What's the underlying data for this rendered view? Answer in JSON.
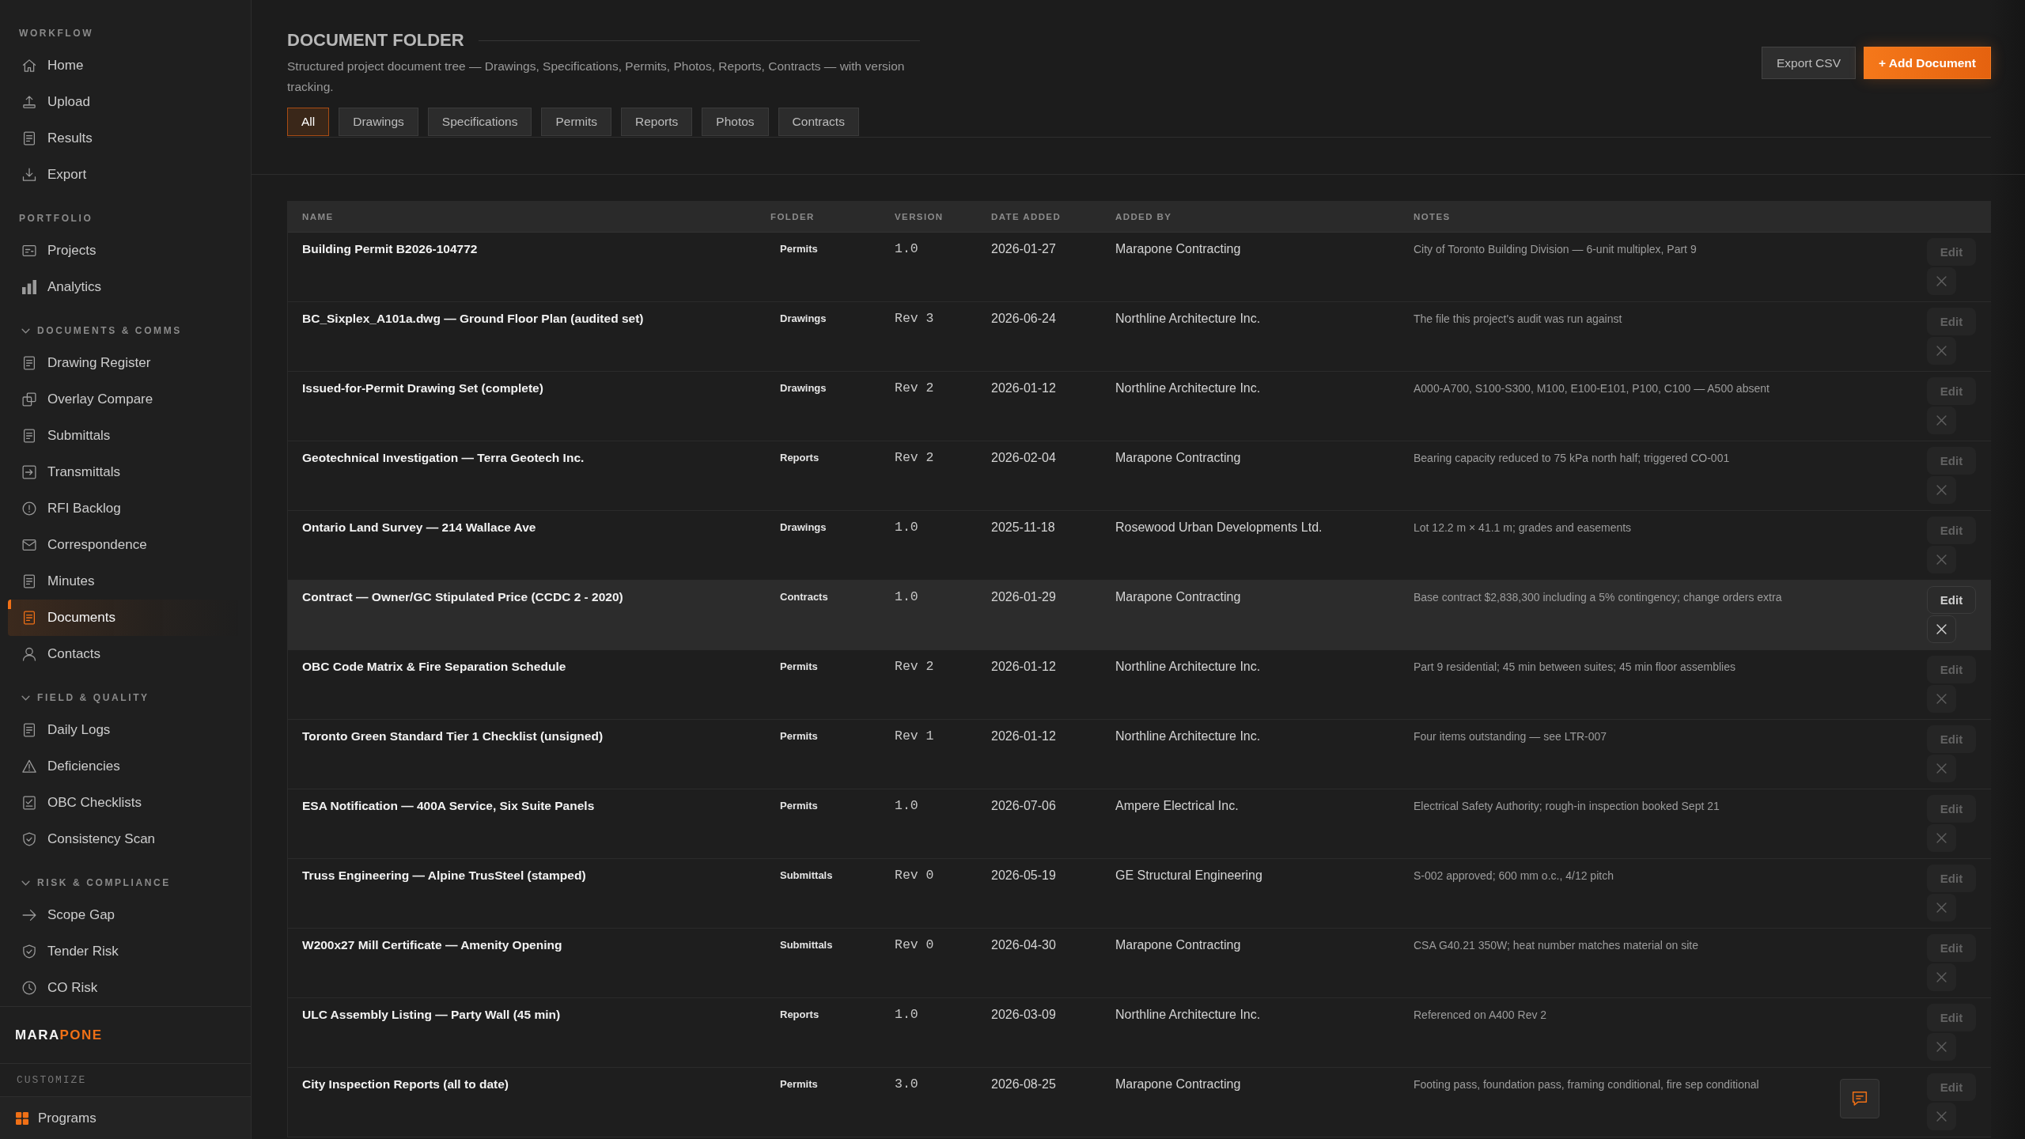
{
  "sidebar": {
    "sections": [
      {
        "label": "WORKFLOW",
        "items": [
          {
            "label": "Home",
            "selected": false
          },
          {
            "label": "Upload",
            "selected": false
          },
          {
            "label": "Results",
            "selected": false
          },
          {
            "label": "Export",
            "selected": false
          }
        ]
      },
      {
        "label": "PORTFOLIO",
        "items": [
          {
            "label": "Projects",
            "selected": false
          },
          {
            "label": "Analytics",
            "selected": false
          }
        ]
      },
      {
        "label": "DOCUMENTS & COMMS",
        "expanded": true,
        "items": [
          {
            "label": "Drawing Register",
            "selected": false
          },
          {
            "label": "Overlay Compare",
            "selected": false
          },
          {
            "label": "Submittals",
            "selected": false
          },
          {
            "label": "Transmittals",
            "selected": false
          },
          {
            "label": "RFI Backlog",
            "selected": false
          },
          {
            "label": "Correspondence",
            "selected": false
          },
          {
            "label": "Minutes",
            "selected": false
          },
          {
            "label": "Documents",
            "selected": true
          },
          {
            "label": "Contacts",
            "selected": false
          }
        ]
      },
      {
        "label": "FIELD & QUALITY",
        "expanded": true,
        "items": [
          {
            "label": "Daily Logs",
            "selected": false
          },
          {
            "label": "Deficiencies",
            "selected": false
          },
          {
            "label": "OBC Checklists",
            "selected": false
          },
          {
            "label": "Consistency Scan",
            "selected": false
          }
        ]
      },
      {
        "label": "RISK & COMPLIANCE",
        "expanded": true,
        "items": [
          {
            "label": "Scope Gap",
            "selected": false
          },
          {
            "label": "Tender Risk",
            "selected": false
          },
          {
            "label": "CO Risk",
            "selected": false
          }
        ]
      }
    ],
    "brand": {
      "first": "MARA",
      "second": "PONE"
    },
    "customize": {
      "label": "CUSTOMIZE",
      "item": "Programs"
    }
  },
  "header": {
    "title": "DOCUMENT FOLDER",
    "subtitle": "Structured project document tree — Drawings, Specifications, Permits, Photos, Reports, Contracts — with version tracking.",
    "actions": [
      {
        "label": "Export CSV",
        "kind": "secondary"
      },
      {
        "label": "+ Add Document",
        "kind": "primary"
      }
    ],
    "tabs": [
      {
        "label": "All",
        "selected": true
      },
      {
        "label": "Drawings",
        "selected": false
      },
      {
        "label": "Specifications",
        "selected": false
      },
      {
        "label": "Permits",
        "selected": false
      },
      {
        "label": "Reports",
        "selected": false
      },
      {
        "label": "Photos",
        "selected": false
      },
      {
        "label": "Contracts",
        "selected": false
      }
    ]
  },
  "table": {
    "columns": [
      "NAME",
      "FOLDER",
      "VERSION",
      "DATE ADDED",
      "ADDED BY",
      "NOTES"
    ],
    "rows": [
      {
        "name": "Building Permit B2026-104772",
        "folder": "Permits",
        "version": "1.0",
        "date_added": "2026-01-27",
        "added_by": "Marapone Contracting",
        "notes": "City of Toronto Building Division — 6-unit multiplex, Part 9",
        "action": "Edit",
        "selected": false
      },
      {
        "name": "BC_Sixplex_A101a.dwg — Ground Floor Plan (audited set)",
        "folder": "Drawings",
        "version": "Rev 3",
        "date_added": "2026-06-24",
        "added_by": "Northline Architecture Inc.",
        "notes": "The file this project's audit was run against",
        "action": "Edit",
        "selected": false
      },
      {
        "name": "Issued-for-Permit Drawing Set (complete)",
        "folder": "Drawings",
        "version": "Rev 2",
        "date_added": "2026-01-12",
        "added_by": "Northline Architecture Inc.",
        "notes": "A000-A700, S100-S300, M100, E100-E101, P100, C100 — A500 absent",
        "action": "Edit",
        "selected": false
      },
      {
        "name": "Geotechnical Investigation — Terra Geotech Inc.",
        "folder": "Reports",
        "version": "Rev 2",
        "date_added": "2026-02-04",
        "added_by": "Marapone Contracting",
        "notes": "Bearing capacity reduced to 75 kPa north half; triggered CO-001",
        "action": "Edit",
        "selected": false
      },
      {
        "name": "Ontario Land Survey — 214 Wallace Ave",
        "folder": "Drawings",
        "version": "1.0",
        "date_added": "2025-11-18",
        "added_by": "Rosewood Urban Developments Ltd.",
        "notes": "Lot 12.2 m × 41.1 m; grades and easements",
        "action": "Edit",
        "selected": false
      },
      {
        "name": "Contract — Owner/GC Stipulated Price (CCDC 2 - 2020)",
        "folder": "Contracts",
        "version": "1.0",
        "date_added": "2026-01-29",
        "added_by": "Marapone Contracting",
        "notes": "Base contract $2,838,300 including a 5% contingency; change orders extra",
        "action": "Edit",
        "selected": true
      },
      {
        "name": "OBC Code Matrix & Fire Separation Schedule",
        "folder": "Permits",
        "version": "Rev 2",
        "date_added": "2026-01-12",
        "added_by": "Northline Architecture Inc.",
        "notes": "Part 9 residential; 45 min between suites; 45 min floor assemblies",
        "action": "Edit",
        "selected": false
      },
      {
        "name": "Toronto Green Standard Tier 1 Checklist (unsigned)",
        "folder": "Permits",
        "version": "Rev 1",
        "date_added": "2026-01-12",
        "added_by": "Northline Architecture Inc.",
        "notes": "Four items outstanding — see LTR-007",
        "action": "Edit",
        "selected": false
      },
      {
        "name": "ESA Notification — 400A Service, Six Suite Panels",
        "folder": "Permits",
        "version": "1.0",
        "date_added": "2026-07-06",
        "added_by": "Ampere Electrical Inc.",
        "notes": "Electrical Safety Authority; rough-in inspection booked Sept 21",
        "action": "Edit",
        "selected": false
      },
      {
        "name": "Truss Engineering — Alpine TrusSteel (stamped)",
        "folder": "Submittals",
        "version": "Rev 0",
        "date_added": "2026-05-19",
        "added_by": "GE Structural Engineering",
        "notes": "S-002 approved; 600 mm o.c., 4/12 pitch",
        "action": "Edit",
        "selected": false
      },
      {
        "name": "W200x27 Mill Certificate — Amenity Opening",
        "folder": "Submittals",
        "version": "Rev 0",
        "date_added": "2026-04-30",
        "added_by": "Marapone Contracting",
        "notes": "CSA G40.21 350W; heat number matches material on site",
        "action": "Edit",
        "selected": false
      },
      {
        "name": "ULC Assembly Listing — Party Wall (45 min)",
        "folder": "Reports",
        "version": "1.0",
        "date_added": "2026-03-09",
        "added_by": "Northline Architecture Inc.",
        "notes": "Referenced on A400 Rev 2",
        "action": "Edit",
        "selected": false
      },
      {
        "name": "City Inspection Reports (all to date)",
        "folder": "Permits",
        "version": "3.0",
        "date_added": "2026-08-25",
        "added_by": "Marapone Contracting",
        "notes": "Footing pass, foundation pass, framing conditional, fire sep conditional",
        "action": "Edit",
        "selected": false
      }
    ]
  }
}
